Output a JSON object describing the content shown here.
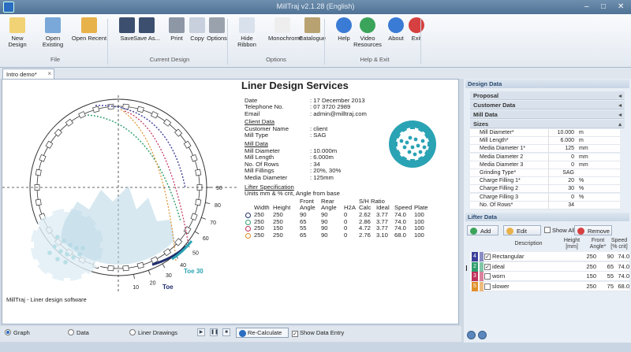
{
  "window": {
    "title": "MillTraj v2.1.28   (English)",
    "controls": [
      "–",
      "□",
      "✕"
    ]
  },
  "ribbon": {
    "buttons": [
      {
        "label": "New Design",
        "icon": "new-design-icon",
        "color": "#f1d275"
      },
      {
        "label": "Open Existing",
        "icon": "open-existing-icon",
        "color": "#7aa8d8"
      },
      {
        "label": "Open Recent",
        "icon": "folder-icon",
        "color": "#e8b24a"
      },
      {
        "label": "Save",
        "icon": "save-icon",
        "color": "#3c4f6f"
      },
      {
        "label": "Save As...",
        "icon": "save-as-icon",
        "color": "#3c4f6f"
      },
      {
        "label": "Print",
        "icon": "print-icon",
        "color": "#8d97a6"
      },
      {
        "label": "Copy",
        "icon": "copy-icon",
        "color": "#c7d0dc"
      },
      {
        "label": "Options",
        "icon": "gear-icon",
        "color": "#9aa3ad"
      },
      {
        "label": "Hide Ribbon",
        "icon": "hide-ribbon-icon",
        "color": "#d9e1ec"
      },
      {
        "label": "Monochrome",
        "icon": "monochrome-icon",
        "color": "#eeeeee"
      },
      {
        "label": "Catalogue",
        "icon": "catalogue-icon",
        "color": "#b9a271"
      },
      {
        "label": "Help",
        "icon": "help-icon",
        "color": "#3a7bd5"
      },
      {
        "label": "Video Resources",
        "icon": "globe-icon",
        "color": "#3aa45a"
      },
      {
        "label": "About",
        "icon": "info-icon",
        "color": "#3a7bd5"
      },
      {
        "label": "Exit",
        "icon": "exit-icon",
        "color": "#d64040"
      }
    ],
    "groups": [
      "File",
      "Current Design",
      "Options",
      "Help & Exit"
    ]
  },
  "document_tab": {
    "label": "Intro demo*",
    "close": "×"
  },
  "report": {
    "title": "Liner Design Services",
    "header_labels": "Date\nTelephone No.\nEmail",
    "header_values": ": 17 December 2013\n: 07 3720 2989\n: admin@milltraj.com",
    "client_heading": "Client Data",
    "client_labels": "Customer Name\nMill Type",
    "client_values": ": client\n: SAG",
    "mill_heading": "Mill Data",
    "mill_labels": "Mill Diameter\nMill Length\nNo. Of Rows\nMill Fillings\nMedia Diameter",
    "mill_values": ": 10.000m\n: 6.000m\n: 34\n: 20%, 30%\n: 125mm",
    "lifter_heading": "Lifter Specification",
    "units_note": "Units mm & % crit, Angle from base",
    "col_heads": [
      "\nWidth",
      "\nHeight",
      "Front\nAngle",
      "Rear\nAngle",
      "\nH2A",
      "S/H Ratio\nCalc",
      "\nIdeal",
      "\nSpeed",
      "\nPlate"
    ],
    "rows": [
      {
        "color": "#1f2e6e",
        "cells": [
          "250",
          "250",
          "90",
          "90",
          "0",
          "2.62",
          "3.77",
          "74.0",
          "100"
        ]
      },
      {
        "color": "#2e9e6e",
        "cells": [
          "250",
          "250",
          "65",
          "90",
          "0",
          "2.86",
          "3.77",
          "74.0",
          "100"
        ]
      },
      {
        "color": "#c0305a",
        "cells": [
          "250",
          "150",
          "55",
          "90",
          "0",
          "4.72",
          "3.77",
          "74.0",
          "100"
        ]
      },
      {
        "color": "#e0902a",
        "cells": [
          "250",
          "250",
          "65",
          "90",
          "0",
          "2.76",
          "3.10",
          "68.0",
          "100"
        ]
      }
    ]
  },
  "graph": {
    "angle_labels": [
      "90",
      "80",
      "70",
      "60",
      "50",
      "40",
      "30",
      "20",
      "10"
    ],
    "toe30_label": "Toe 30",
    "toe_label": "Toe",
    "footer": "MillTraj - Liner design software"
  },
  "bottom": {
    "radios": [
      {
        "label": "Graph",
        "selected": true
      },
      {
        "label": "Data",
        "selected": false
      },
      {
        "label": "Liner Drawings",
        "selected": false
      }
    ],
    "step_buttons": [
      "▶",
      "❚❚",
      "■"
    ],
    "recalc": "Re-Calculate",
    "show_data_entry": "Show Data Entry",
    "show_data_checked": "✓"
  },
  "design_panel": {
    "title": "Design Data",
    "sections": [
      "Proposal",
      "Customer Data",
      "Mill Data",
      "Sizes"
    ],
    "section_arrows": [
      "◂",
      "◂",
      "◂",
      "▴"
    ],
    "props": [
      {
        "label": "Mill Diameter*",
        "value": "10.000",
        "unit": "m"
      },
      {
        "label": "Mill Length*",
        "value": "6.000",
        "unit": "m"
      },
      {
        "label": "Media Diameter 1*",
        "value": "125",
        "unit": "mm"
      },
      {
        "label": "Media Diameter 2",
        "value": "0",
        "unit": "mm"
      },
      {
        "label": "Media Diameter 3",
        "value": "0",
        "unit": "mm"
      },
      {
        "label": "Grinding Type*",
        "value": "SAG",
        "unit": ""
      },
      {
        "label": "Charge Filling 1*",
        "value": "20",
        "unit": "%"
      },
      {
        "label": "Charge Filling 2",
        "value": "30",
        "unit": "%"
      },
      {
        "label": "Charge Filling 3",
        "value": "0",
        "unit": "%"
      },
      {
        "label": "No. Of Rows*",
        "value": "34",
        "unit": ""
      }
    ]
  },
  "lifter_panel": {
    "title": "Lifter Data",
    "buttons": [
      "Add",
      "Edit",
      "Remove"
    ],
    "show_all": "Show All",
    "headers": {
      "description": "Description",
      "height": "Height\n[mm]",
      "angle": "Front\nAngle*",
      "speed": "Speed\n[% crit]"
    },
    "rows": [
      {
        "num": "4",
        "color": "#3b3f9a",
        "checked": true,
        "description": "Rectangular",
        "height": "250",
        "angle": "90",
        "speed": "74.0"
      },
      {
        "num": "2",
        "color": "#2e9e6e",
        "checked": true,
        "description": "ideal",
        "height": "250",
        "angle": "65",
        "speed": "74.0"
      },
      {
        "num": "3",
        "color": "#c0305a",
        "checked": false,
        "description": "worn",
        "height": "150",
        "angle": "55",
        "speed": "74.0"
      },
      {
        "num": "5",
        "color": "#e0902a",
        "checked": false,
        "description": "slower",
        "height": "250",
        "angle": "75",
        "speed": "68.0"
      }
    ]
  },
  "colors": {
    "accent": "#2a6cc0",
    "teal": "#2aa3b4",
    "charge": "#b7d6e4"
  }
}
